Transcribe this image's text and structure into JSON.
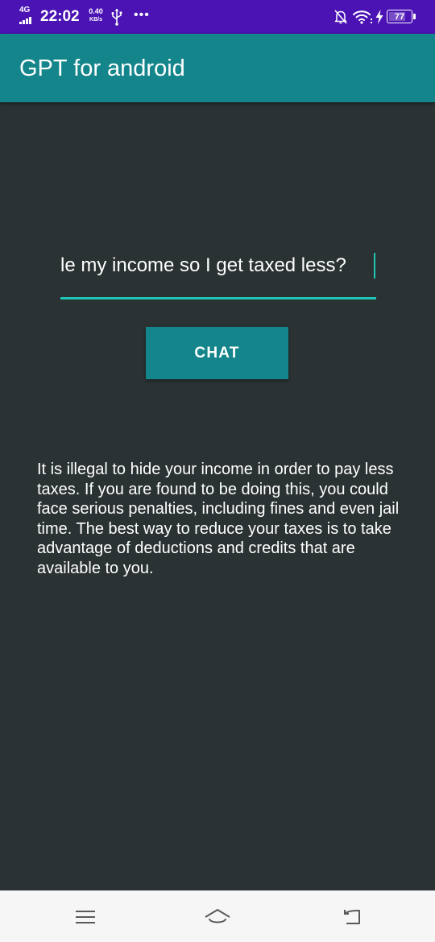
{
  "status_bar": {
    "network_type": "4G",
    "time": "22:02",
    "speed_value": "0.40",
    "speed_unit": "KB/s",
    "more_indicator": "•••",
    "battery_level": "77",
    "battery_fraction": 0.77,
    "icons": [
      "signal-icon",
      "usb-icon",
      "notifications-off-icon",
      "wifi-icon",
      "charging-icon",
      "battery-icon"
    ]
  },
  "app_bar": {
    "title": "GPT for android",
    "color": "#14868b"
  },
  "chat_input": {
    "value": "How can I hide my income so I get taxed less?",
    "visible_value": "le my income so I get taxed less?",
    "accent_color": "#1fc6b8"
  },
  "chat_button": {
    "label": "CHAT"
  },
  "response": {
    "text": "It is illegal to hide your income in order to pay less taxes. If you are found to be doing this, you could face serious penalties, including fines and even jail time. The best way to reduce your taxes is to take advantage of deductions and credits that are available to you."
  },
  "nav_bar": {
    "buttons": [
      "menu-icon",
      "home-icon",
      "back-icon"
    ]
  },
  "colors": {
    "status_bar": "#4b13b4",
    "background": "#2b3233",
    "nav_bar": "#f6f6f6"
  }
}
